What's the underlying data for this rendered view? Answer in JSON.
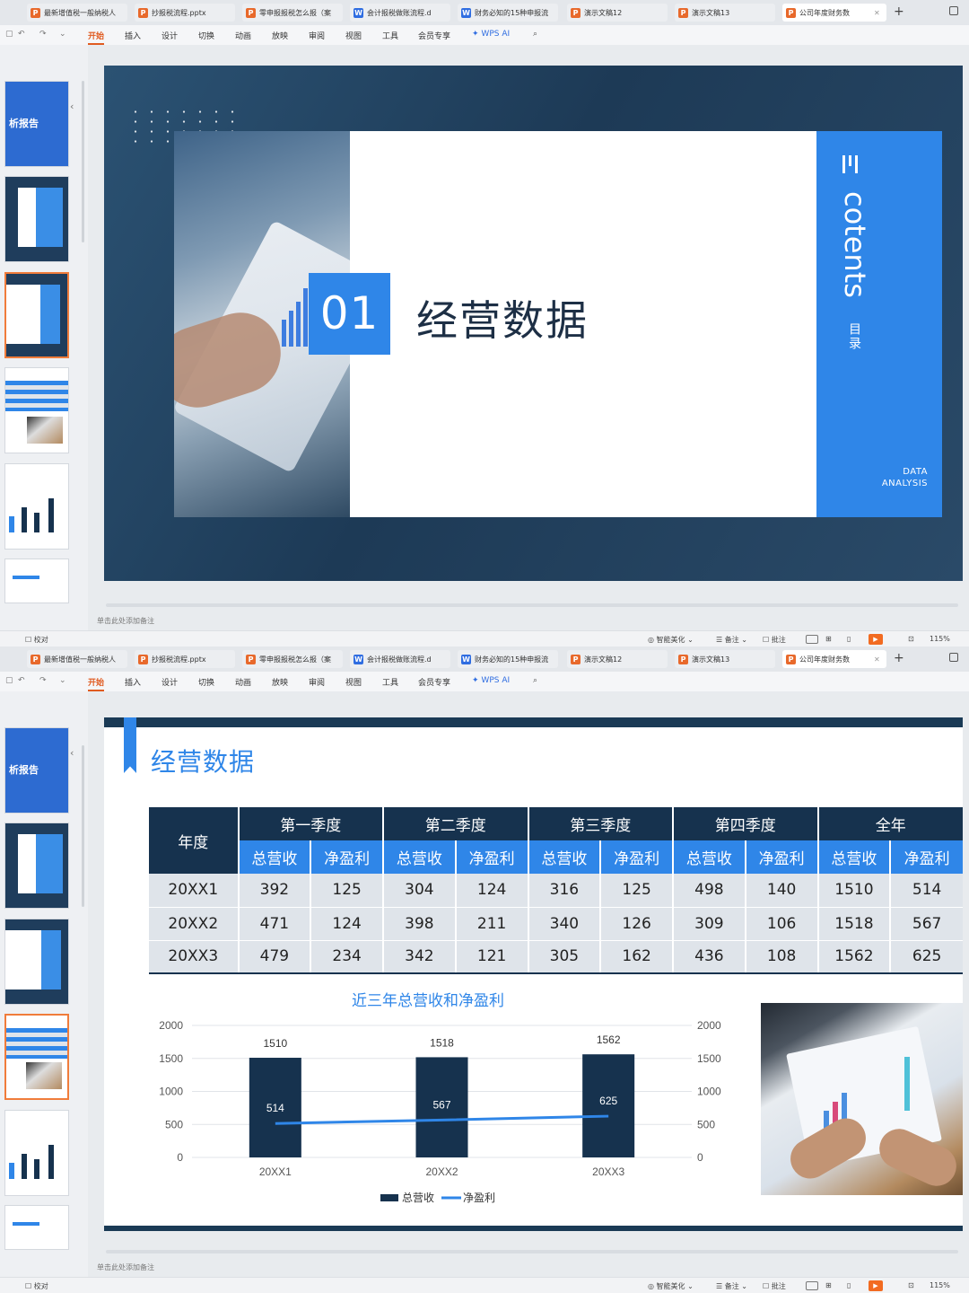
{
  "tabs": [
    {
      "type": "P",
      "label": "最新增值税一般纳税人"
    },
    {
      "type": "P",
      "label": "抄报税流程.pptx"
    },
    {
      "type": "P",
      "label": "零申报报税怎么报（案"
    },
    {
      "type": "W",
      "label": "会计报税做账流程.d"
    },
    {
      "type": "W",
      "label": "财务必知的15种申报流"
    },
    {
      "type": "P",
      "label": "演示文稿12"
    },
    {
      "type": "P",
      "label": "演示文稿13"
    },
    {
      "type": "P",
      "label": "公司年度财务数"
    }
  ],
  "ribbon": {
    "items": [
      "开始",
      "插入",
      "设计",
      "切换",
      "动画",
      "放映",
      "审阅",
      "视图",
      "工具",
      "会员专享"
    ],
    "active": "开始",
    "ai": "WPS AI"
  },
  "thumbnails": {
    "report_text": "析报告"
  },
  "notes_placeholder": "单击此处添加备注",
  "status": {
    "proofread": "校对",
    "beautify": "智能美化",
    "notes": "备注",
    "comment": "批注",
    "zoom": "115%"
  },
  "slide1": {
    "number": "01",
    "title": "经营数据",
    "side_en": "cotents",
    "side_cn": "目录",
    "tag": "DATA ANALYSIS",
    "colors": {
      "accent": "#2f86e8",
      "dark": "#1c3a57"
    }
  },
  "slide2": {
    "title": "经营数据",
    "table": {
      "year_header": "年度",
      "quarters": [
        "第一季度",
        "第二季度",
        "第三季度",
        "第四季度",
        "全年"
      ],
      "sub_headers": [
        "总营收",
        "净盈利"
      ],
      "rows": [
        {
          "year": "20XX1",
          "values": [
            "392",
            "125",
            "304",
            "124",
            "316",
            "125",
            "498",
            "140",
            "1510",
            "514"
          ]
        },
        {
          "year": "20XX2",
          "values": [
            "471",
            "124",
            "398",
            "211",
            "340",
            "126",
            "309",
            "106",
            "1518",
            "567"
          ]
        },
        {
          "year": "20XX3",
          "values": [
            "479",
            "234",
            "342",
            "121",
            "305",
            "162",
            "436",
            "108",
            "1562",
            "625"
          ]
        }
      ]
    }
  },
  "chart_data": {
    "type": "bar",
    "title": "近三年总营收和净盈利",
    "categories": [
      "20XX1",
      "20XX2",
      "20XX3"
    ],
    "series": [
      {
        "name": "总营收",
        "type": "bar",
        "color": "#16324e",
        "values": [
          1510,
          1518,
          1562
        ]
      },
      {
        "name": "净盈利",
        "type": "line",
        "color": "#2f86e8",
        "values": [
          514,
          567,
          625
        ]
      }
    ],
    "ylim": [
      0,
      2000
    ],
    "yticks": [
      0,
      500,
      1000,
      1500,
      2000
    ],
    "secondary_yticks": [
      0,
      500,
      1000,
      1500,
      2000
    ],
    "grid": true,
    "legend": "bottom"
  }
}
